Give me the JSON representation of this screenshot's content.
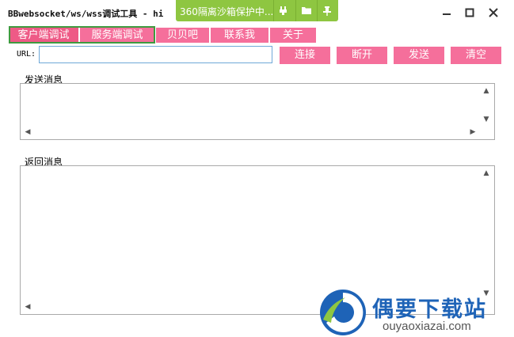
{
  "window": {
    "title": "BBwebsocket/ws/wss调试工具 - hi",
    "sandbox_text": "360隔离沙箱保护中..."
  },
  "tabs": [
    {
      "label": "客户端调试"
    },
    {
      "label": "服务端调试"
    },
    {
      "label": "贝贝吧"
    },
    {
      "label": "联系我"
    },
    {
      "label": "关于"
    }
  ],
  "url": {
    "label": "URL:",
    "value": "",
    "placeholder": ""
  },
  "buttons": {
    "connect": "连接",
    "disconnect": "断开",
    "send": "发送",
    "clear": "清空"
  },
  "send_section": {
    "label": "发送消息"
  },
  "return_section": {
    "label": "返回消息"
  },
  "watermark": {
    "brand": "偶要下载站",
    "url": "ouyaoxiazai.com"
  },
  "colors": {
    "tab_pink": "#f56f9b",
    "sandbox_green": "#8ec641",
    "outline_green": "#3f9a3f",
    "brand_blue": "#1e63b7"
  }
}
